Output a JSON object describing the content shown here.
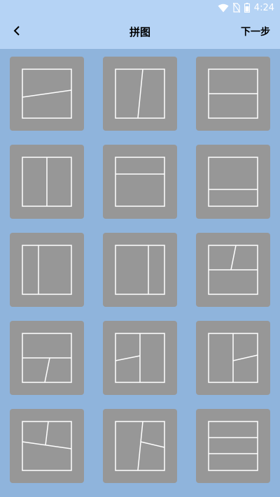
{
  "status": {
    "time": "4:24",
    "wifi_icon": "wifi-icon",
    "sim_icon": "no-sim-icon",
    "battery_icon": "battery-icon"
  },
  "header": {
    "title": "拼图",
    "next_label": "下一步",
    "back_icon": "chevron-left-icon"
  },
  "colors": {
    "bar": "#b5d3f5",
    "background": "#8fb4dc",
    "tile": "#979797",
    "line": "#ffffff"
  },
  "templates": [
    {
      "name": "layout-two-slanted-horizontal"
    },
    {
      "name": "layout-two-slanted-vertical"
    },
    {
      "name": "layout-two-horizontal"
    },
    {
      "name": "layout-two-vertical"
    },
    {
      "name": "layout-two-top-narrow"
    },
    {
      "name": "layout-two-bottom-narrow"
    },
    {
      "name": "layout-two-left-narrow"
    },
    {
      "name": "layout-two-right-narrow"
    },
    {
      "name": "layout-three-top-split"
    },
    {
      "name": "layout-three-bottom-split"
    },
    {
      "name": "layout-three-left-split"
    },
    {
      "name": "layout-three-right-split"
    },
    {
      "name": "layout-three-slanted-a"
    },
    {
      "name": "layout-three-slanted-b"
    },
    {
      "name": "layout-three-horizontal"
    }
  ]
}
